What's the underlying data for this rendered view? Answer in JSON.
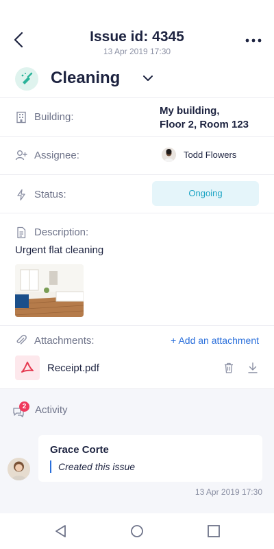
{
  "header": {
    "title": "Issue id: 4345",
    "subtitle": "13 Apr 2019 17:30",
    "back_icon": "chevron-left-icon",
    "more_icon": "more-dots-icon"
  },
  "category": {
    "label": "Cleaning",
    "icon": "cleaning-brush-icon",
    "accent": "#2bb39a"
  },
  "building": {
    "label": "Building:",
    "value_line1": "My building,",
    "value_line2": "Floor 2, Room 123",
    "icon": "building-icon"
  },
  "assignee": {
    "label": "Assignee:",
    "name": "Todd Flowers",
    "icon": "person-add-icon"
  },
  "status": {
    "label": "Status:",
    "value": "Ongoing",
    "icon": "bolt-icon",
    "color": "#1aa3c3",
    "bg": "#e5f5fa"
  },
  "description": {
    "label": "Description:",
    "text": "Urgent flat cleaning",
    "icon": "document-icon"
  },
  "attachments": {
    "label": "Attachments:",
    "add_label": "+ Add an attachment",
    "icon": "paperclip-icon",
    "files": [
      {
        "name": "Receipt.pdf",
        "icon": "pdf-icon"
      }
    ]
  },
  "activity": {
    "label": "Activity",
    "count": "2",
    "icon": "chat-icon",
    "comments": [
      {
        "author": "Grace Corte",
        "text": "Created this issue",
        "time": "13 Apr 2019 17:30"
      }
    ]
  },
  "colors": {
    "primary_text": "#1d2340",
    "secondary_text": "#6e7389",
    "link": "#2a6fdb",
    "badge": "#ef3a5d",
    "pdf": "#e53950"
  }
}
